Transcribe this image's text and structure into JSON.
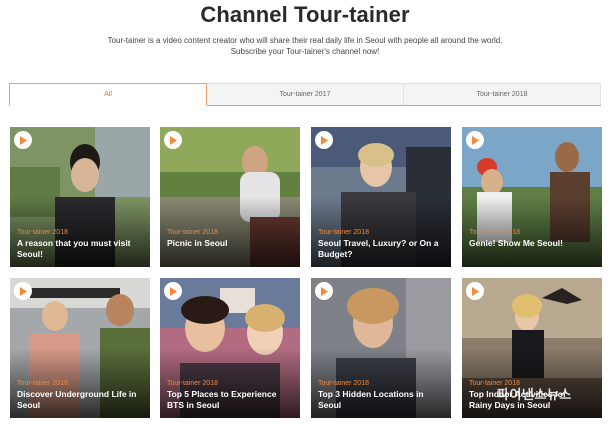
{
  "page": {
    "title": "Channel Tour-tainer",
    "description_line1": "Tour-tainer is a video content creator who will share their real daily life in Seoul with people all around the world.",
    "description_line2": "Subscribe your Tour-tainer's channel now!"
  },
  "tabs": [
    {
      "label": "All",
      "active": true
    },
    {
      "label": "Tour-tainer 2017",
      "active": false
    },
    {
      "label": "Tour-tainer 2018",
      "active": false
    }
  ],
  "videos": [
    {
      "category": "Tour-tainer 2018",
      "title_line1": "A reason that you must visit",
      "title_line2": "Seoul!",
      "icon": "play-icon",
      "palette": [
        "#6f7f5a",
        "#3a4a3e",
        "#c9b49a"
      ]
    },
    {
      "category": "Tour-tainer 2018",
      "title_line1": "Picnic in Seoul",
      "title_line2": "",
      "icon": "play-icon",
      "palette": [
        "#55743e",
        "#93a06a",
        "#d8c8b0"
      ]
    },
    {
      "category": "Tour-tainer 2018",
      "title_line1": "Seoul Travel, Luxury? or On a",
      "title_line2": "Budget?",
      "icon": "play-icon",
      "palette": [
        "#4a5a7a",
        "#8a8f99",
        "#e6d2b8"
      ]
    },
    {
      "category": "Tour-tainer 2018",
      "title_line1": "Genie! Show Me Seoul!",
      "title_line2": "",
      "icon": "play-icon",
      "palette": [
        "#5f8fb5",
        "#6a8a4a",
        "#c8a27a"
      ]
    },
    {
      "category": "Tour-tainer 2018",
      "title_line1": "Discover Underground Life in",
      "title_line2": "Seoul",
      "icon": "play-icon",
      "palette": [
        "#a0a6aa",
        "#5a5f58",
        "#d9a57a"
      ]
    },
    {
      "category": "Tour-tainer 2018",
      "title_line1": "Top 5 Places to Experience",
      "title_line2": "BTS in Seoul",
      "icon": "play-icon",
      "palette": [
        "#b36a7a",
        "#6a4a5a",
        "#e8c2a8"
      ]
    },
    {
      "category": "Tour-tainer 2018",
      "title_line1": "Top 3 Hidden Locations in",
      "title_line2": "Seoul",
      "icon": "play-icon",
      "palette": [
        "#7a7e86",
        "#3a3e46",
        "#d8b898"
      ]
    },
    {
      "category": "Tour-tainer 2018",
      "title_line1": "Top Indoor Activities for",
      "title_line2": "Rainy Days in Seoul",
      "icon": "play-icon",
      "palette": [
        "#8a7a68",
        "#4a3e36",
        "#d8c0a8"
      ]
    }
  ],
  "watermark": "파이낸스뉴스",
  "colors": {
    "accent": "#f08a3c",
    "tab_active": "#e0742e",
    "title": "#2a2a2a"
  }
}
